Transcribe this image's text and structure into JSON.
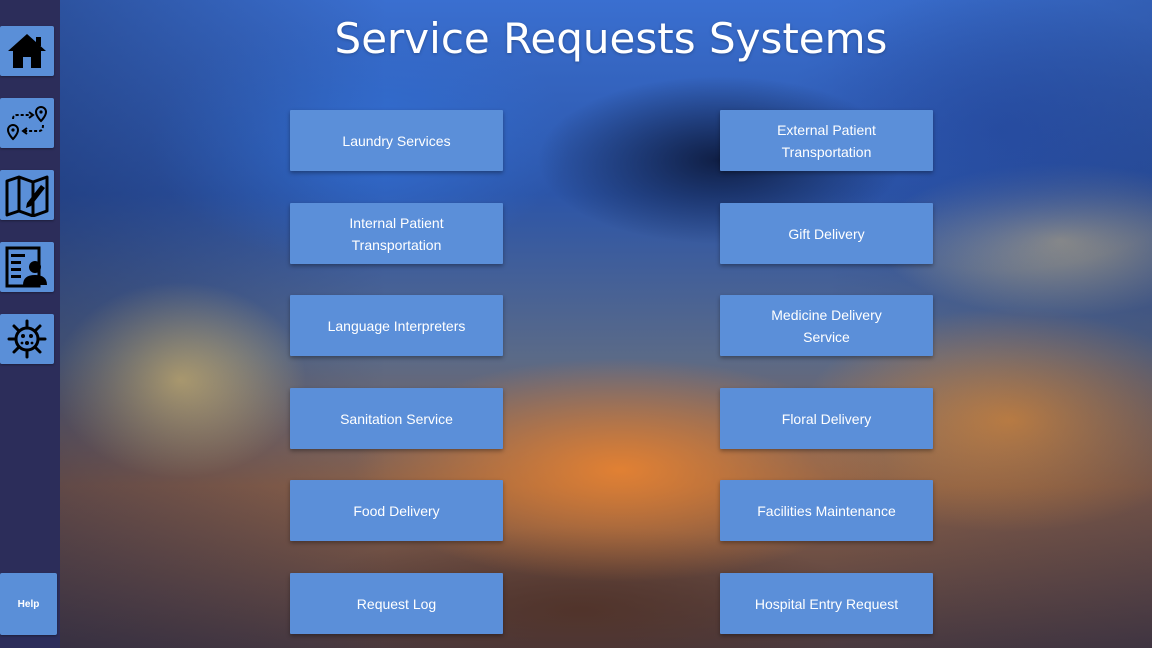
{
  "page": {
    "title": "Service Requests Systems"
  },
  "sidebar": {
    "items": [
      {
        "name": "home",
        "icon": "home-icon"
      },
      {
        "name": "pathfinding",
        "icon": "route-icon"
      },
      {
        "name": "map-editor",
        "icon": "map-edit-icon"
      },
      {
        "name": "patient-info",
        "icon": "profile-card-icon"
      },
      {
        "name": "covid",
        "icon": "virus-icon"
      }
    ],
    "help_label": "Help"
  },
  "services": {
    "left": [
      "Laundry Services",
      "Internal Patient Transportation",
      "Language Interpreters",
      "Sanitation Service",
      "Food Delivery",
      "Request Log"
    ],
    "right": [
      "External Patient Transportation",
      "Gift Delivery",
      "Medicine Delivery Service",
      "Floral Delivery",
      "Facilities Maintenance",
      "Hospital Entry Request"
    ]
  },
  "colors": {
    "sidebar_bg": "#2c2d5a",
    "button_bg": "#5b8fd9",
    "text": "#ffffff"
  }
}
